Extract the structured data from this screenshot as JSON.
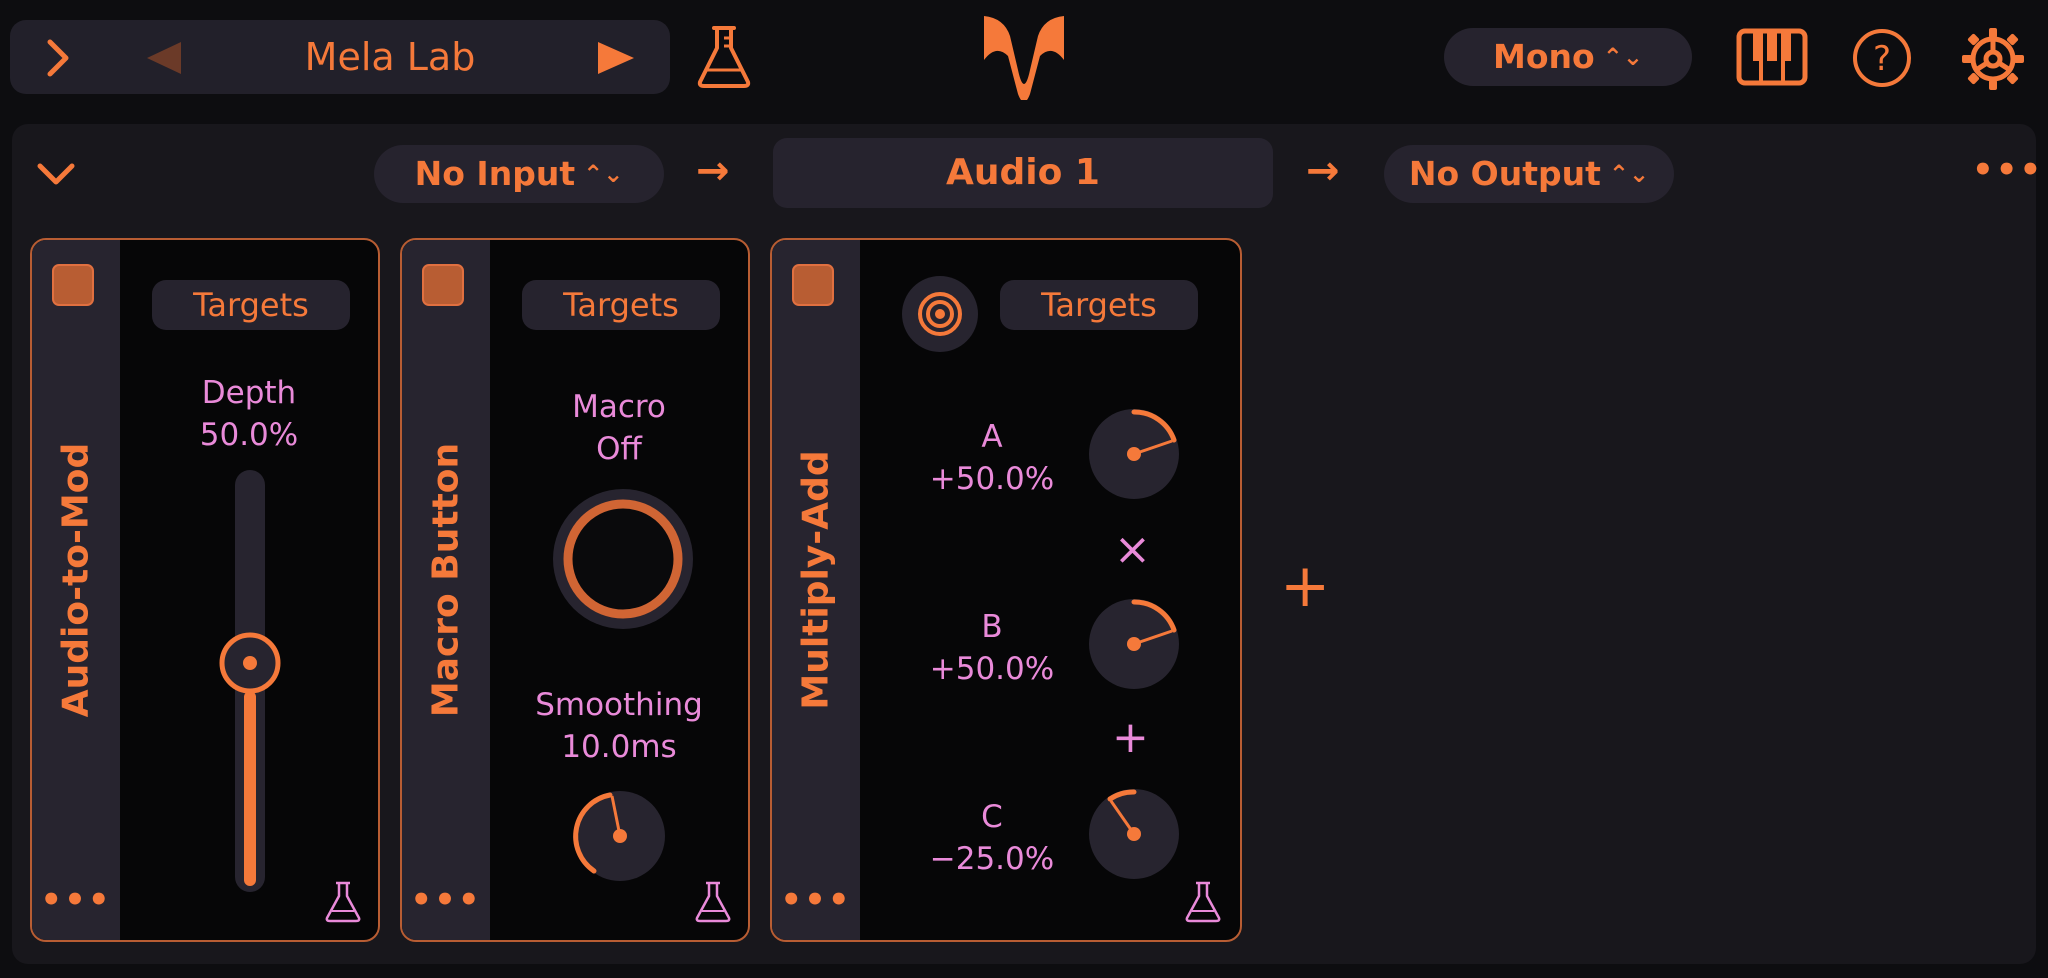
{
  "topbar": {
    "preset_name": "Mela Lab",
    "voice_mode": "Mono",
    "icons": [
      "chevron-right-icon",
      "previous-icon",
      "play-icon",
      "flask-icon",
      "logo",
      "piano-keys-icon",
      "help-icon",
      "settings-icon"
    ]
  },
  "chain": {
    "input": "No Input",
    "name": "Audio 1",
    "output": "No Output",
    "more": "•••"
  },
  "modules": [
    {
      "title": "Audio-to-Mod",
      "targets_label": "Targets",
      "param_name": "Depth",
      "param_value": "50.0%",
      "slider_value": 0.5,
      "more": "•••"
    },
    {
      "title": "Macro Button",
      "targets_label": "Targets",
      "macro_name": "Macro",
      "macro_state": "Off",
      "param_name": "Smoothing",
      "param_value": "10.0ms",
      "more": "•••"
    },
    {
      "title": "Multiply-Add",
      "targets_label": "Targets",
      "params": [
        {
          "name": "A",
          "value": "+50.0%"
        },
        {
          "name": "B",
          "value": "+50.0%"
        },
        {
          "name": "C",
          "value": "−25.0%"
        }
      ],
      "op1": "×",
      "op2": "+",
      "more": "•••"
    }
  ],
  "add_module": "+",
  "colors": {
    "accent": "#f5793a",
    "pink": "#e98ad9",
    "panel": "#18171c",
    "card": "#060607",
    "pill": "#26232e"
  }
}
